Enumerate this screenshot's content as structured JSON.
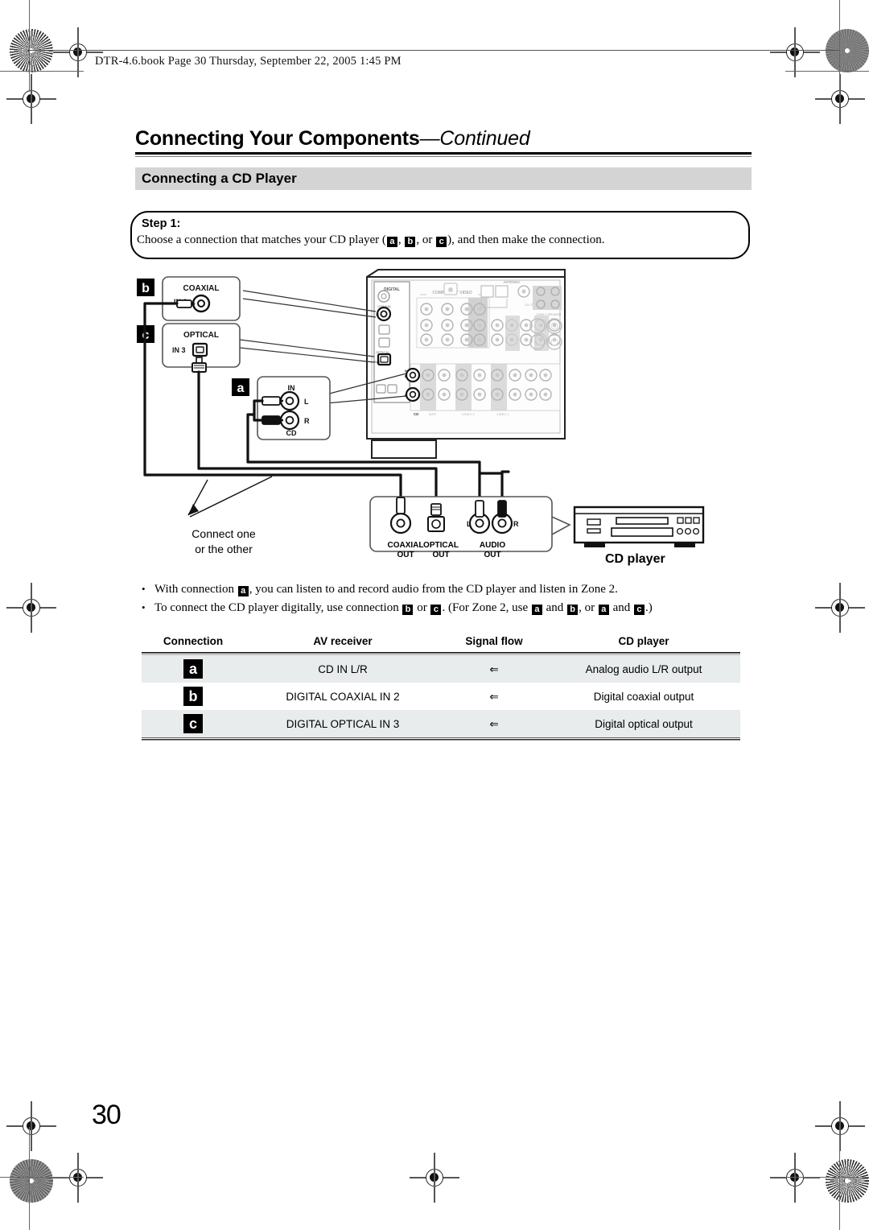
{
  "file_header": "DTR-4.6.book  Page 30  Thursday, September 22, 2005  1:45 PM",
  "chapter": {
    "title_main": "Connecting Your Components",
    "title_dash": "—",
    "title_cont": "Continued"
  },
  "section": {
    "heading": "Connecting a CD Player"
  },
  "step": {
    "label": "Step 1:",
    "text_before": "Choose a connection that matches your CD player (",
    "badge_a": "a",
    "sep1": ", ",
    "badge_b": "b",
    "sep2": ", or ",
    "badge_c": "c",
    "text_after": "), and then make the connection."
  },
  "diagram": {
    "callout_b_label": "b",
    "callout_b_title": "COAXIAL",
    "callout_b_jack": "IN 2",
    "callout_c_label": "c",
    "callout_c_title": "OPTICAL",
    "callout_c_jack": "IN 3",
    "callout_a_label": "a",
    "callout_a_in": "IN",
    "callout_a_left": "L",
    "callout_a_right": "R",
    "callout_a_cd": "CD",
    "connect_note_line1": "Connect one",
    "connect_note_line2": "or the other",
    "cd_coaxial_out_line1": "COAXIAL",
    "cd_coaxial_out_line2": "OUT",
    "cd_optical_out_line1": "OPTICAL",
    "cd_optical_out_line2": "OUT",
    "cd_audio_out_line1": "AUDIO",
    "cd_audio_out_line2": "OUT",
    "cd_audio_l": "L",
    "cd_audio_r": "R",
    "cd_player_caption": "CD player",
    "receiver_digital": "DIGITAL",
    "receiver_coaxial": "COAXIAL",
    "receiver_optical": "OPTICAL",
    "receiver_component_video": "COMPONENT VIDEO",
    "receiver_antenna": "ANTENNA",
    "receiver_cd": "CD"
  },
  "notes": [
    {
      "bullet": "•",
      "parts": [
        {
          "type": "text",
          "value": "With connection "
        },
        {
          "type": "badge",
          "value": "a"
        },
        {
          "type": "text",
          "value": ", you can listen to and record audio from the CD player and listen in Zone 2."
        }
      ]
    },
    {
      "bullet": "•",
      "parts": [
        {
          "type": "text",
          "value": "To connect the CD player digitally, use connection "
        },
        {
          "type": "badge",
          "value": "b"
        },
        {
          "type": "text",
          "value": " or "
        },
        {
          "type": "badge",
          "value": "c"
        },
        {
          "type": "text",
          "value": ". (For Zone 2, use "
        },
        {
          "type": "badge",
          "value": "a"
        },
        {
          "type": "text",
          "value": " and "
        },
        {
          "type": "badge",
          "value": "b"
        },
        {
          "type": "text",
          "value": ", or "
        },
        {
          "type": "badge",
          "value": "a"
        },
        {
          "type": "text",
          "value": " and "
        },
        {
          "type": "badge",
          "value": "c"
        },
        {
          "type": "text",
          "value": ".)"
        }
      ]
    }
  ],
  "table": {
    "headers": [
      "Connection",
      "AV receiver",
      "Signal flow",
      "CD player"
    ],
    "rows": [
      {
        "connection": "a",
        "av_receiver": "CD IN L/R",
        "signal_flow": "⇐",
        "cd_player": "Analog audio L/R output"
      },
      {
        "connection": "b",
        "av_receiver": "DIGITAL COAXIAL IN 2",
        "signal_flow": "⇐",
        "cd_player": "Digital coaxial output"
      },
      {
        "connection": "c",
        "av_receiver": "DIGITAL OPTICAL IN 3",
        "signal_flow": "⇐",
        "cd_player": "Digital optical output"
      }
    ]
  },
  "page_number": "30",
  "colors": {
    "section_band": "#d4d4d4",
    "table_row_shade": "#e8ecec",
    "badge_bg": "#000000"
  }
}
